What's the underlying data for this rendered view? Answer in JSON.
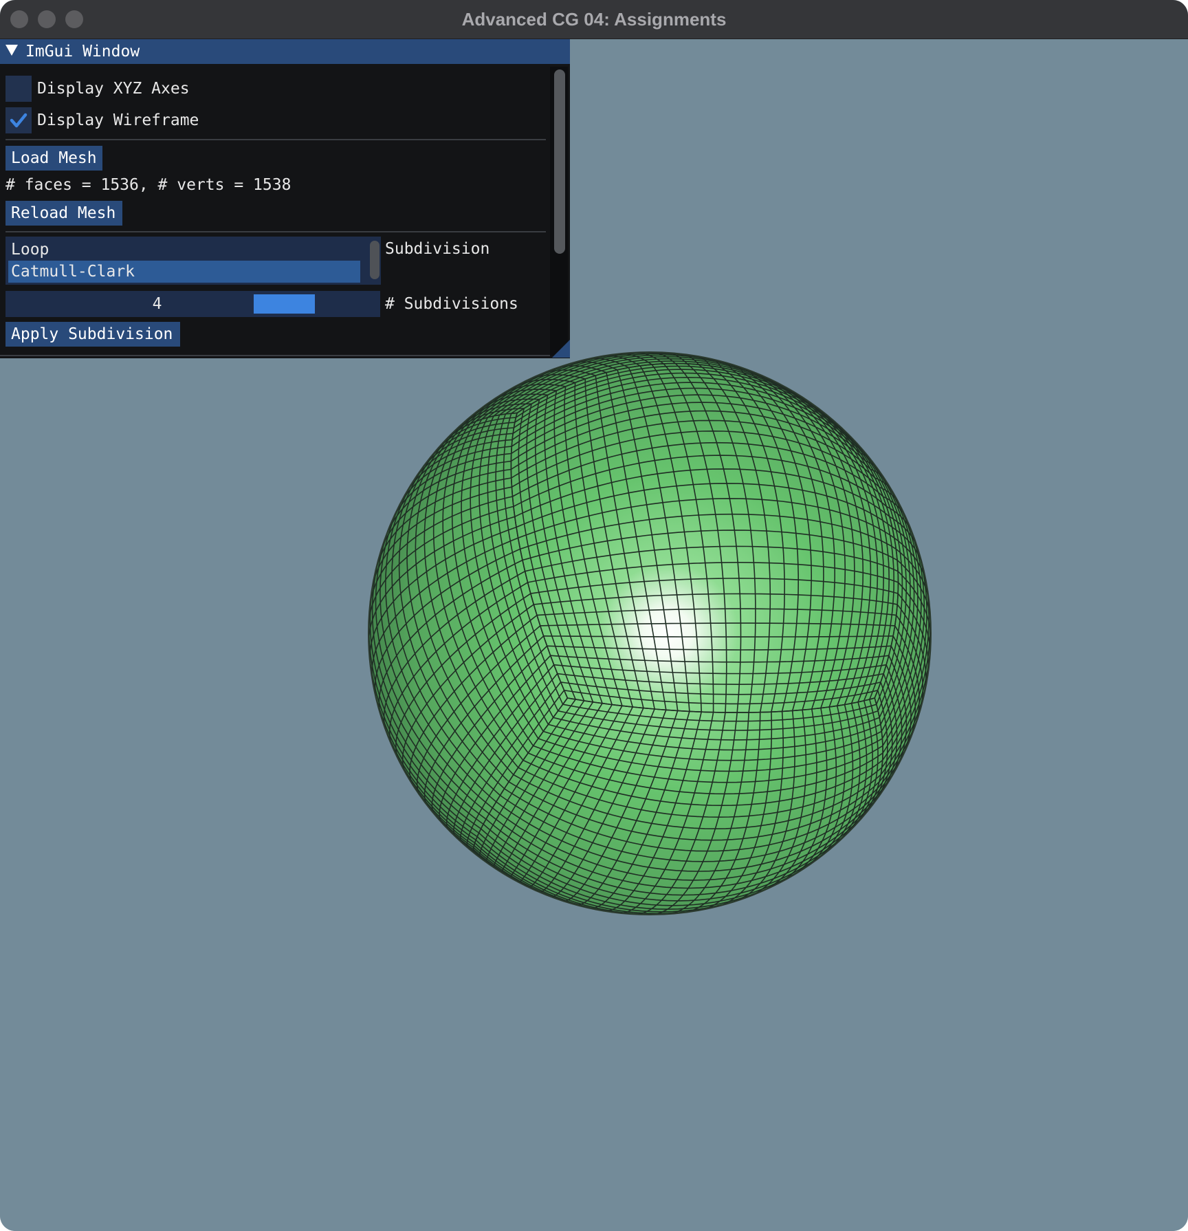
{
  "window": {
    "title": "Advanced CG 04: Assignments"
  },
  "imgui": {
    "title": "ImGui Window",
    "display_axes": {
      "label": "Display XYZ Axes",
      "checked": false
    },
    "display_wireframe": {
      "label": "Display Wireframe",
      "checked": true
    },
    "load_mesh_label": "Load Mesh",
    "mesh_info": "# faces = 1536, # verts = 1538",
    "reload_mesh_label": "Reload Mesh",
    "subdivision": {
      "label": "Subdivision",
      "options": [
        "Loop",
        "Catmull-Clark"
      ],
      "selected": "Catmull-Clark"
    },
    "subdivisions": {
      "label": "# Subdivisions",
      "value": "4"
    },
    "apply_label": "Apply Subdivision"
  },
  "colors": {
    "viewport_background": "#738b99",
    "mesh_base": "#5cbf6a",
    "mesh_highlight": "#ffffff",
    "wireframe": "#1f2d24",
    "imgui_accent": "#294a7a",
    "slider_grab": "#3d84e0"
  }
}
